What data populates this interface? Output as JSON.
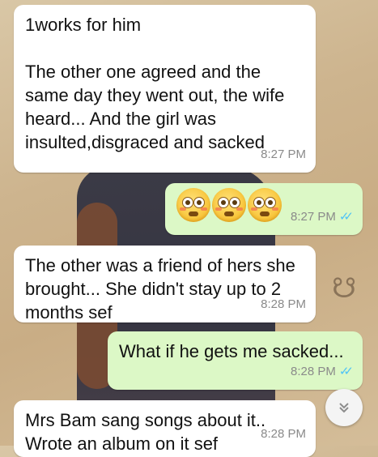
{
  "messages": [
    {
      "direction": "incoming",
      "text": "1works for him\n\nThe other one agreed and the same day they went out, the wife heard... And the girl was insulted,disgraced and sacked",
      "time": "8:27 PM"
    },
    {
      "direction": "outgoing",
      "emoji": [
        "flushed-face",
        "flushed-face",
        "flushed-face"
      ],
      "time": "8:27 PM",
      "status_icon": "double-check-read-icon"
    },
    {
      "direction": "incoming",
      "text": "The other was a friend of hers she brought... She didn't stay up to 2 months sef",
      "time": "8:28 PM"
    },
    {
      "direction": "outgoing",
      "text": "What if he gets me sacked...",
      "time": "8:28 PM",
      "status_icon": "double-check-read-icon"
    },
    {
      "direction": "incoming",
      "text": "Mrs Bam sang songs about it..\nWrote an album on it sef",
      "time": "8:28 PM"
    }
  ],
  "scroll_button": {
    "icon": "double-chevron-down-icon"
  },
  "colors": {
    "incoming_bubble": "#ffffff",
    "outgoing_bubble": "#dcf8c6",
    "read_ticks": "#4fc3f7",
    "timestamp": "#8a8a8a"
  }
}
